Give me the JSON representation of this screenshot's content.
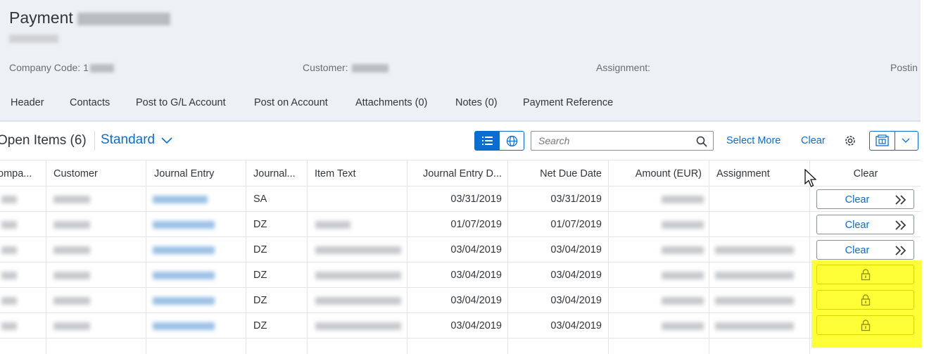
{
  "page": {
    "title": "Payment",
    "header_fields": {
      "company_code_label": "Company Code:",
      "company_code_visible": "1",
      "customer_label": "Customer:",
      "assignment_label": "Assignment:",
      "posting_label": "Postin"
    },
    "tabs": [
      "Header",
      "Contacts",
      "Post to G/L Account",
      "Post on Account",
      "Attachments (0)",
      "Notes (0)",
      "Payment Reference"
    ]
  },
  "toolbar": {
    "title": "Open Items (6)",
    "variant": "Standard",
    "search_placeholder": "Search",
    "select_more": "Select More",
    "clear": "Clear",
    "icons": [
      "list-view-icon",
      "globe-icon",
      "search-icon",
      "gear-icon",
      "export-icon",
      "chevron-down-icon"
    ]
  },
  "table": {
    "columns": [
      "ompa...",
      "Customer",
      "Journal Entry",
      "Journal...",
      "Item Text",
      "Journal Entry D...",
      "Net Due Date",
      "Amount (EUR)",
      "Assignment",
      "Clear"
    ],
    "rows": [
      {
        "type": "SA",
        "journal_date": "03/31/2019",
        "net_due": "03/31/2019",
        "action": "clear"
      },
      {
        "type": "DZ",
        "journal_date": "01/07/2019",
        "net_due": "01/07/2019",
        "action": "clear"
      },
      {
        "type": "DZ",
        "journal_date": "03/04/2019",
        "net_due": "03/04/2019",
        "action": "clear"
      },
      {
        "type": "DZ",
        "journal_date": "03/04/2019",
        "net_due": "03/04/2019",
        "action": "locked"
      },
      {
        "type": "DZ",
        "journal_date": "03/04/2019",
        "net_due": "03/04/2019",
        "action": "locked"
      },
      {
        "type": "DZ",
        "journal_date": "03/04/2019",
        "net_due": "03/04/2019",
        "action": "locked"
      }
    ],
    "clear_button_label": "Clear",
    "highlight_color": "#ffff38"
  },
  "colors": {
    "brand": "#0a6ed1",
    "header_bg": "#edf1f5",
    "text": "#32363a"
  }
}
